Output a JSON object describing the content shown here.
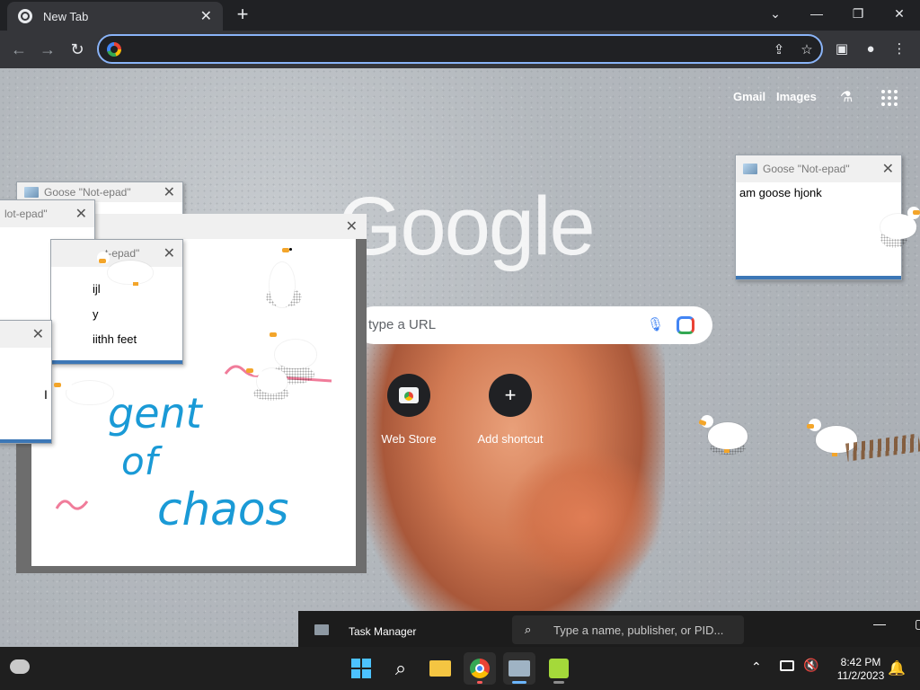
{
  "browser": {
    "tab_title": "New Tab",
    "omnibox_value": ""
  },
  "page": {
    "links": {
      "gmail": "Gmail",
      "images": "Images"
    },
    "logo_text": "Google",
    "search_placeholder": "type a URL",
    "shortcuts": [
      {
        "label": "Web Store",
        "icon": "web-store-icon"
      },
      {
        "label": "Add shortcut",
        "icon": "plus-icon"
      }
    ]
  },
  "goose_windows": {
    "right": {
      "title": "Goose \"Not-epad\"",
      "text": "am goose hjonk"
    },
    "stack_title": "Goose \"Not-epad\"",
    "left_title_partial": "lot-epad\"",
    "mid_title_partial": "t-epad\"",
    "mid_text_lines": [
      "ijl",
      "y",
      "iithh feet"
    ],
    "drawing_text": [
      "gent",
      "of",
      "chaos"
    ]
  },
  "task_manager": {
    "title": "Task Manager",
    "search_placeholder": "Type a name, publisher, or PID..."
  },
  "taskbar": {
    "time": "8:42 PM",
    "date": "11/2/2023",
    "apps": [
      "start-icon",
      "search-icon",
      "file-explorer-icon",
      "chrome-icon",
      "task-manager-icon",
      "goose-app-icon"
    ]
  },
  "colors": {
    "accent_blue": "#8ab4f8",
    "chrome_dark": "#202124",
    "toolbar": "#35363a",
    "note_footer": "#3c77b6",
    "taskbar": "#1f1f1f",
    "drawing_blue": "#1a9ad6",
    "drawing_pink": "#f07c9a"
  }
}
